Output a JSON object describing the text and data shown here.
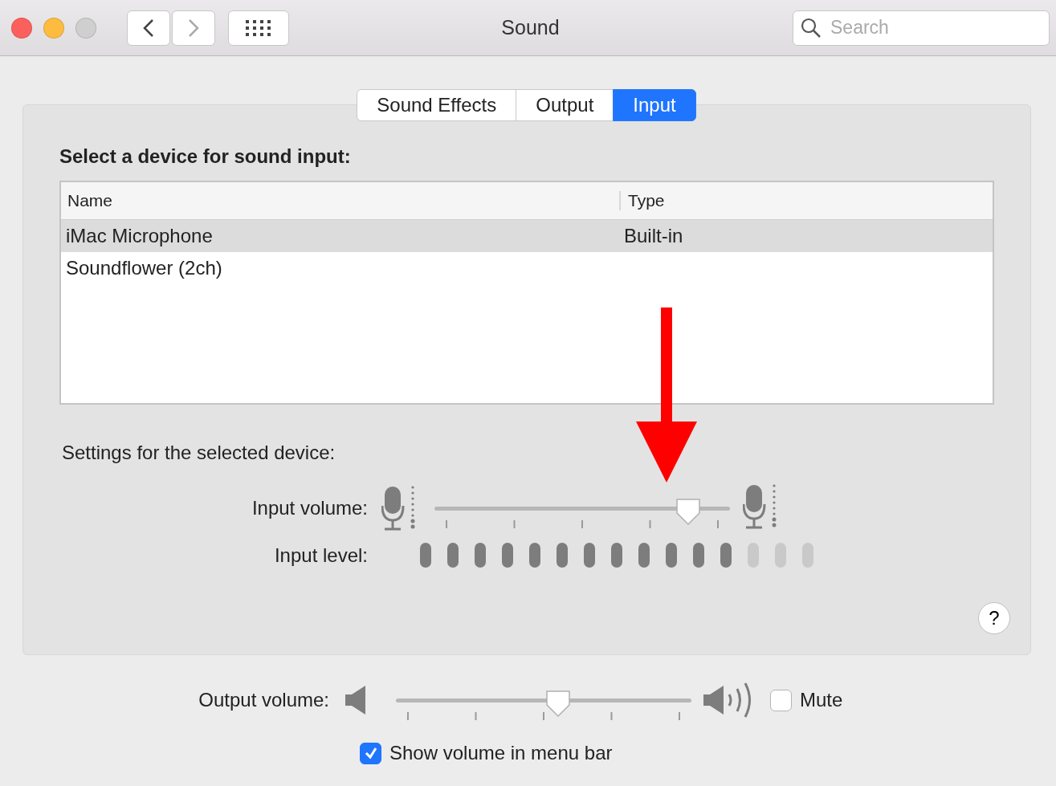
{
  "window": {
    "title": "Sound"
  },
  "search": {
    "placeholder": "Search"
  },
  "tabs": [
    {
      "label": "Sound Effects",
      "selected": false
    },
    {
      "label": "Output",
      "selected": false
    },
    {
      "label": "Input",
      "selected": true
    }
  ],
  "device_heading": "Select a device for sound input:",
  "table": {
    "columns": [
      "Name",
      "Type"
    ],
    "rows": [
      {
        "name": "iMac Microphone",
        "type": "Built-in",
        "selected": true
      },
      {
        "name": "Soundflower (2ch)",
        "selected": false
      }
    ]
  },
  "settings_heading": "Settings for the selected device:",
  "input_volume": {
    "label": "Input volume:",
    "level": 0.86
  },
  "input_level": {
    "label": "Input level:",
    "level": 0.8
  },
  "help_button": "?",
  "output_volume": {
    "label": "Output volume:",
    "level": 0.55
  },
  "mute": {
    "label": "Mute",
    "checked": false
  },
  "show_volume": {
    "label": "Show volume in menu bar",
    "checked": true
  }
}
